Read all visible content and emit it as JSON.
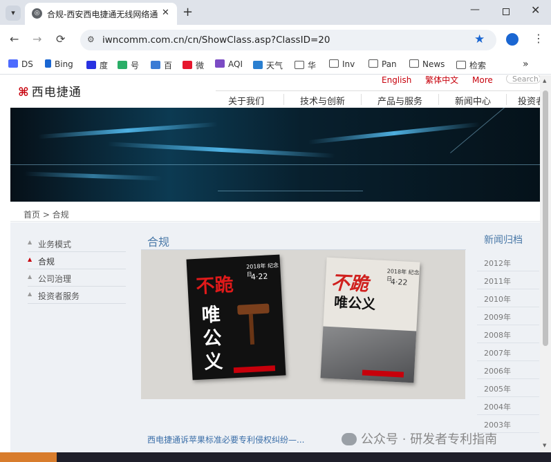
{
  "browser": {
    "tab": {
      "title": "合规-西安西电捷通无线网络通",
      "close": "✕"
    },
    "new_tab": "+",
    "window": {
      "minimize": "—",
      "close": "✕"
    },
    "nav": {
      "back": "←",
      "forward": "→",
      "reload": "⟳"
    },
    "url": "iwncomm.com.cn/cn/ShowClass.asp?ClassID=20",
    "bookmarks": [
      {
        "label": "DS",
        "icon": "deepseek-icon",
        "color": "#4d6bfe"
      },
      {
        "label": "Bing",
        "icon": "search-icon",
        "color": "#1a66d2"
      },
      {
        "label": "度",
        "icon": "baidu-icon",
        "color": "#2932e1"
      },
      {
        "label": "号",
        "icon": "wechat-channels-icon",
        "color": "#2aae67"
      },
      {
        "label": "百",
        "icon": "baike-icon",
        "color": "#3a7bd5"
      },
      {
        "label": "微",
        "icon": "weibo-icon",
        "color": "#e6162d"
      },
      {
        "label": "AQI",
        "icon": "aqi-icon",
        "color": "#7b4bc4"
      },
      {
        "label": "天气",
        "icon": "weather-icon",
        "color": "#2a7fd0"
      },
      {
        "label": "华",
        "icon": "folder-icon"
      },
      {
        "label": "Inv",
        "icon": "folder-icon"
      },
      {
        "label": "Pan",
        "icon": "folder-icon"
      },
      {
        "label": "News",
        "icon": "folder-icon"
      },
      {
        "label": "检索",
        "icon": "folder-icon"
      }
    ],
    "bookmarks_more": "»"
  },
  "site": {
    "logo": "西电捷通",
    "logo_mark": "⌘",
    "lang_links": [
      "English",
      "繁体中文",
      "More"
    ],
    "search_placeholder": "Search",
    "main_nav": [
      "关于我们",
      "技术与创新",
      "产品与服务",
      "新闻中心",
      "投资者"
    ],
    "breadcrumb": "首页 > 合规",
    "side_menu": [
      {
        "label": "业务模式",
        "active": false
      },
      {
        "label": "合规",
        "active": true
      },
      {
        "label": "公司治理",
        "active": false
      },
      {
        "label": "投资者服务",
        "active": false
      }
    ],
    "page_heading": "合规",
    "magazine_left": {
      "big1": "不跪",
      "big2": "唯",
      "big3": "公",
      "big4": "义",
      "date": "4·22",
      "caption": "2018年 纪念日"
    },
    "magazine_right": {
      "big1": "不跪",
      "big2": "唯公义",
      "date": "4·22",
      "caption": "2018年 纪念日"
    },
    "article_link": "西电捷通诉苹果标准必要专利侵权纠纷—...",
    "archive_title": "新闻归档",
    "archive_years": [
      "2012年",
      "2011年",
      "2010年",
      "2009年",
      "2008年",
      "2007年",
      "2006年",
      "2005年",
      "2004年",
      "2003年"
    ]
  },
  "watermark": "公众号 · 研发者专利指南",
  "colors": {
    "accent_red": "#c7000b",
    "heading_blue": "#4a79a8",
    "link_blue": "#3a6ea8",
    "bookmark_star": "#1a66d2"
  }
}
